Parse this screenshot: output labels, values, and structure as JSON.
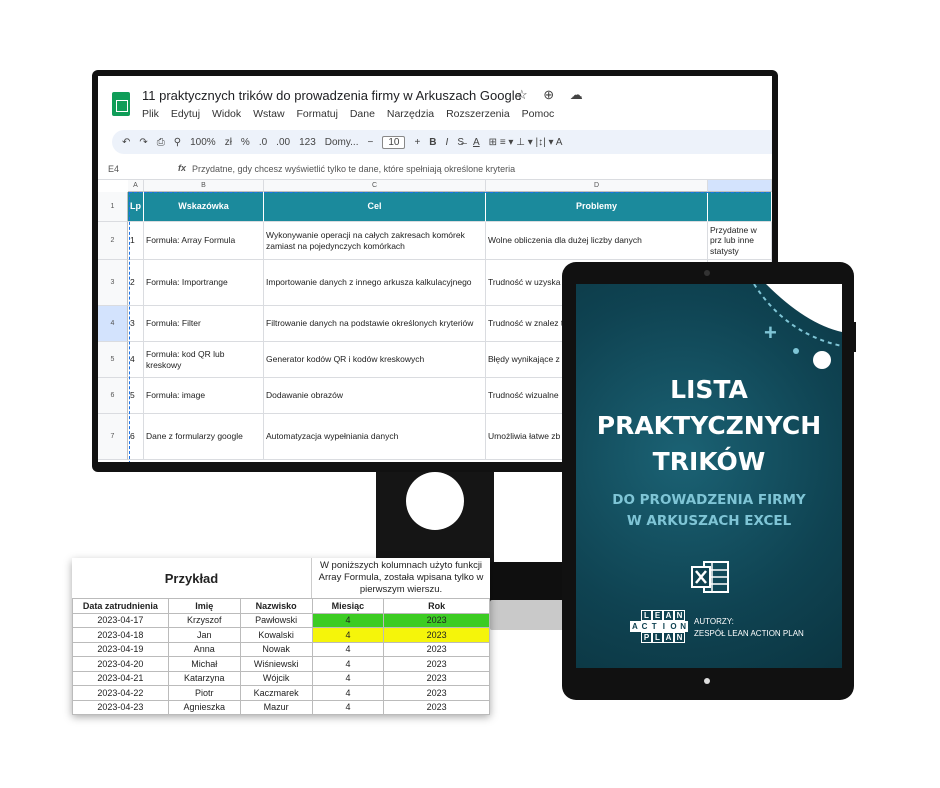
{
  "sheets": {
    "title": "11 praktycznych trików do prowadzenia firmy w Arkuszach Google",
    "title_icons": "☆ ⊕ ☁",
    "menu": [
      "Plik",
      "Edytuj",
      "Widok",
      "Wstaw",
      "Formatuj",
      "Dane",
      "Narzędzia",
      "Rozszerzenia",
      "Pomoc"
    ],
    "toolbar": {
      "undo": "↶",
      "redo": "↷",
      "print": "⎙",
      "paint": "⚲",
      "zoom": "100%",
      "currency": "zł",
      "percent": "%",
      "dec_less": ".0",
      "dec_more": ".00",
      "format_123": "123",
      "font": "Domy...",
      "minus": "−",
      "font_size": "10",
      "plus": "+",
      "bold": "B",
      "italic": "I",
      "strike": "S̶",
      "underline": "A",
      "more": "⊞  ≡ ▾  ⊥ ▾  |↕| ▾  A"
    },
    "cell_ref": "E4",
    "fx": "fx",
    "formula": "Przydatne, gdy chcesz wyświetlić tylko te dane, które spełniają określone kryteria",
    "col_letters": [
      "A",
      "B",
      "C",
      "D"
    ],
    "headers": [
      "Lp",
      "Wskazówka",
      "Cel",
      "Problemy"
    ],
    "rows": [
      {
        "num": "2",
        "lp": "1",
        "tip": "Formuła: Array Formula",
        "goal": "Wykonywanie operacji na całych zakresach komórek zamiast na pojedynczych komórkach",
        "problem": "Wolne obliczenia dla dużej liczby danych",
        "extra": "Przydatne w prz lub inne statysty"
      },
      {
        "num": "3",
        "lp": "2",
        "tip": "Formuła: Importrange",
        "goal": "Importowanie danych z innego arkusza kalkulacyjnego",
        "problem": "Trudność w uzyska arkusza kalkulacyj",
        "extra": ""
      },
      {
        "num": "4",
        "lp": "3",
        "tip": "Formuła: Filter",
        "goal": "Filtrowanie danych na podstawie określonych kryteriów",
        "problem": "Trudność w znalez tabeli",
        "extra": ""
      },
      {
        "num": "5",
        "lp": "4",
        "tip": "Formuła: kod QR lub kreskowy",
        "goal": "Generator kodów QR i kodów kreskowych",
        "problem": "Błędy wynikające z",
        "extra": ""
      },
      {
        "num": "6",
        "lp": "5",
        "tip": "Formuła: image",
        "goal": "Dodawanie obrazów",
        "problem": "Trudność wizualne",
        "extra": ""
      },
      {
        "num": "7",
        "lp": "6",
        "tip": "Dane z formularzy google",
        "goal": "Automatyzacja wypełniania danych",
        "problem": "Umożliwia łatwe zb użytkowników zam",
        "extra": ""
      }
    ]
  },
  "ebook": {
    "title_lines": [
      "LISTA",
      "PRAKTYCZNYCH",
      "TRIKÓW"
    ],
    "subtitle_lines": [
      "DO PROWADZENIA FIRMY",
      "W ARKUSZACH EXCEL"
    ],
    "logo_rows": [
      [
        "L",
        "E",
        "A",
        "N"
      ],
      [
        "A",
        "C",
        "T",
        "I",
        "O",
        "N"
      ],
      [
        "P",
        "L",
        "A",
        "N"
      ]
    ],
    "authors_label": "AUTORZY:",
    "authors_name": "ZESPÓŁ LEAN ACTION PLAN",
    "plus_sign": "+",
    "colors": {
      "background": "#0f4150",
      "accent": "#7fc5d6"
    }
  },
  "example": {
    "title": "Przykład",
    "note": "W poniższych kolumnach użyto funkcji Array Formula, została wpisana tylko w pierwszym wierszu.",
    "headers": [
      "Data zatrudnienia",
      "Imię",
      "Nazwisko",
      "Miesiąc",
      "Rok"
    ],
    "rows": [
      [
        "2023-04-17",
        "Krzyszof",
        "Pawłowski",
        "4",
        "2023"
      ],
      [
        "2023-04-18",
        "Jan",
        "Kowalski",
        "4",
        "2023"
      ],
      [
        "2023-04-19",
        "Anna",
        "Nowak",
        "4",
        "2023"
      ],
      [
        "2023-04-20",
        "Michał",
        "Wiśniewski",
        "4",
        "2023"
      ],
      [
        "2023-04-21",
        "Katarzyna",
        "Wójcik",
        "4",
        "2023"
      ],
      [
        "2023-04-22",
        "Piotr",
        "Kaczmarek",
        "4",
        "2023"
      ],
      [
        "2023-04-23",
        "Agnieszka",
        "Mazur",
        "4",
        "2023"
      ]
    ],
    "highlight_colors": {
      "row1": "#3ccc23",
      "row2": "#f5f50a"
    }
  }
}
